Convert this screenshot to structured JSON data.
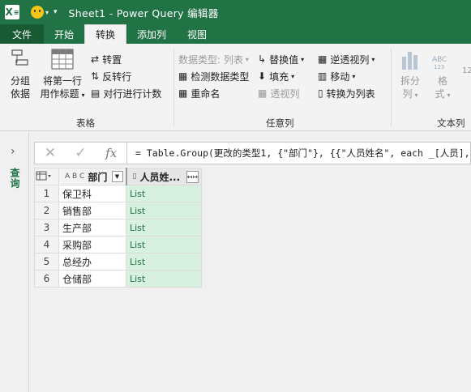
{
  "window": {
    "title": "Sheet1 - Power Query 编辑器",
    "qat_dropdown": "▾"
  },
  "tabs": [
    "文件",
    "开始",
    "转换",
    "添加列",
    "视图"
  ],
  "active_tab": "转换",
  "ribbon": {
    "table_group": {
      "label": "表格",
      "group_by_line1": "分组",
      "group_by_line2": "依据",
      "first_row_line1": "将第一行",
      "first_row_line2": "用作标题",
      "first_row_dd": "▾",
      "transpose": "转置",
      "reverse_rows": "反转行",
      "count_rows": "对行进行计数"
    },
    "any_column_group": {
      "label": "任意列",
      "data_type": "数据类型: 列表",
      "detect_type": "检测数据类型",
      "rename": "重命名",
      "replace_values": "替换值",
      "fill": "填充",
      "pivot_column": "透视列",
      "unpivot_columns": "逆透视列",
      "move": "移动",
      "convert_to_list": "转换为列表"
    },
    "text_column_group": {
      "label": "文本列",
      "split_line1": "拆分",
      "split_line2": "列",
      "format_line1": "格",
      "format_line2": "式",
      "abc_icon_text": "ABC",
      "abc_icon_sub": "123",
      "cut_num": "12"
    }
  },
  "left_pane": {
    "label": "查询",
    "expand": "›"
  },
  "formula_bar": {
    "cancel_icon": "✕",
    "commit_icon": "✓",
    "fx": "fx",
    "formula": "= Table.Group(更改的类型1, {\"部门\"}, {{\"人员姓名\", each _[人员], type"
  },
  "table": {
    "type_icon_col1": "A B C",
    "columns": [
      "部门",
      "人员姓..."
    ],
    "rows": [
      {
        "num": "1",
        "dept": "保卫科",
        "val": "List"
      },
      {
        "num": "2",
        "dept": "销售部",
        "val": "List"
      },
      {
        "num": "3",
        "dept": "生产部",
        "val": "List"
      },
      {
        "num": "4",
        "dept": "采购部",
        "val": "List"
      },
      {
        "num": "5",
        "dept": "总经办",
        "val": "List"
      },
      {
        "num": "6",
        "dept": "仓储部",
        "val": "List"
      }
    ]
  },
  "colors": {
    "brand_green": "#217346",
    "list_cell_bg": "#d8f0e0"
  }
}
